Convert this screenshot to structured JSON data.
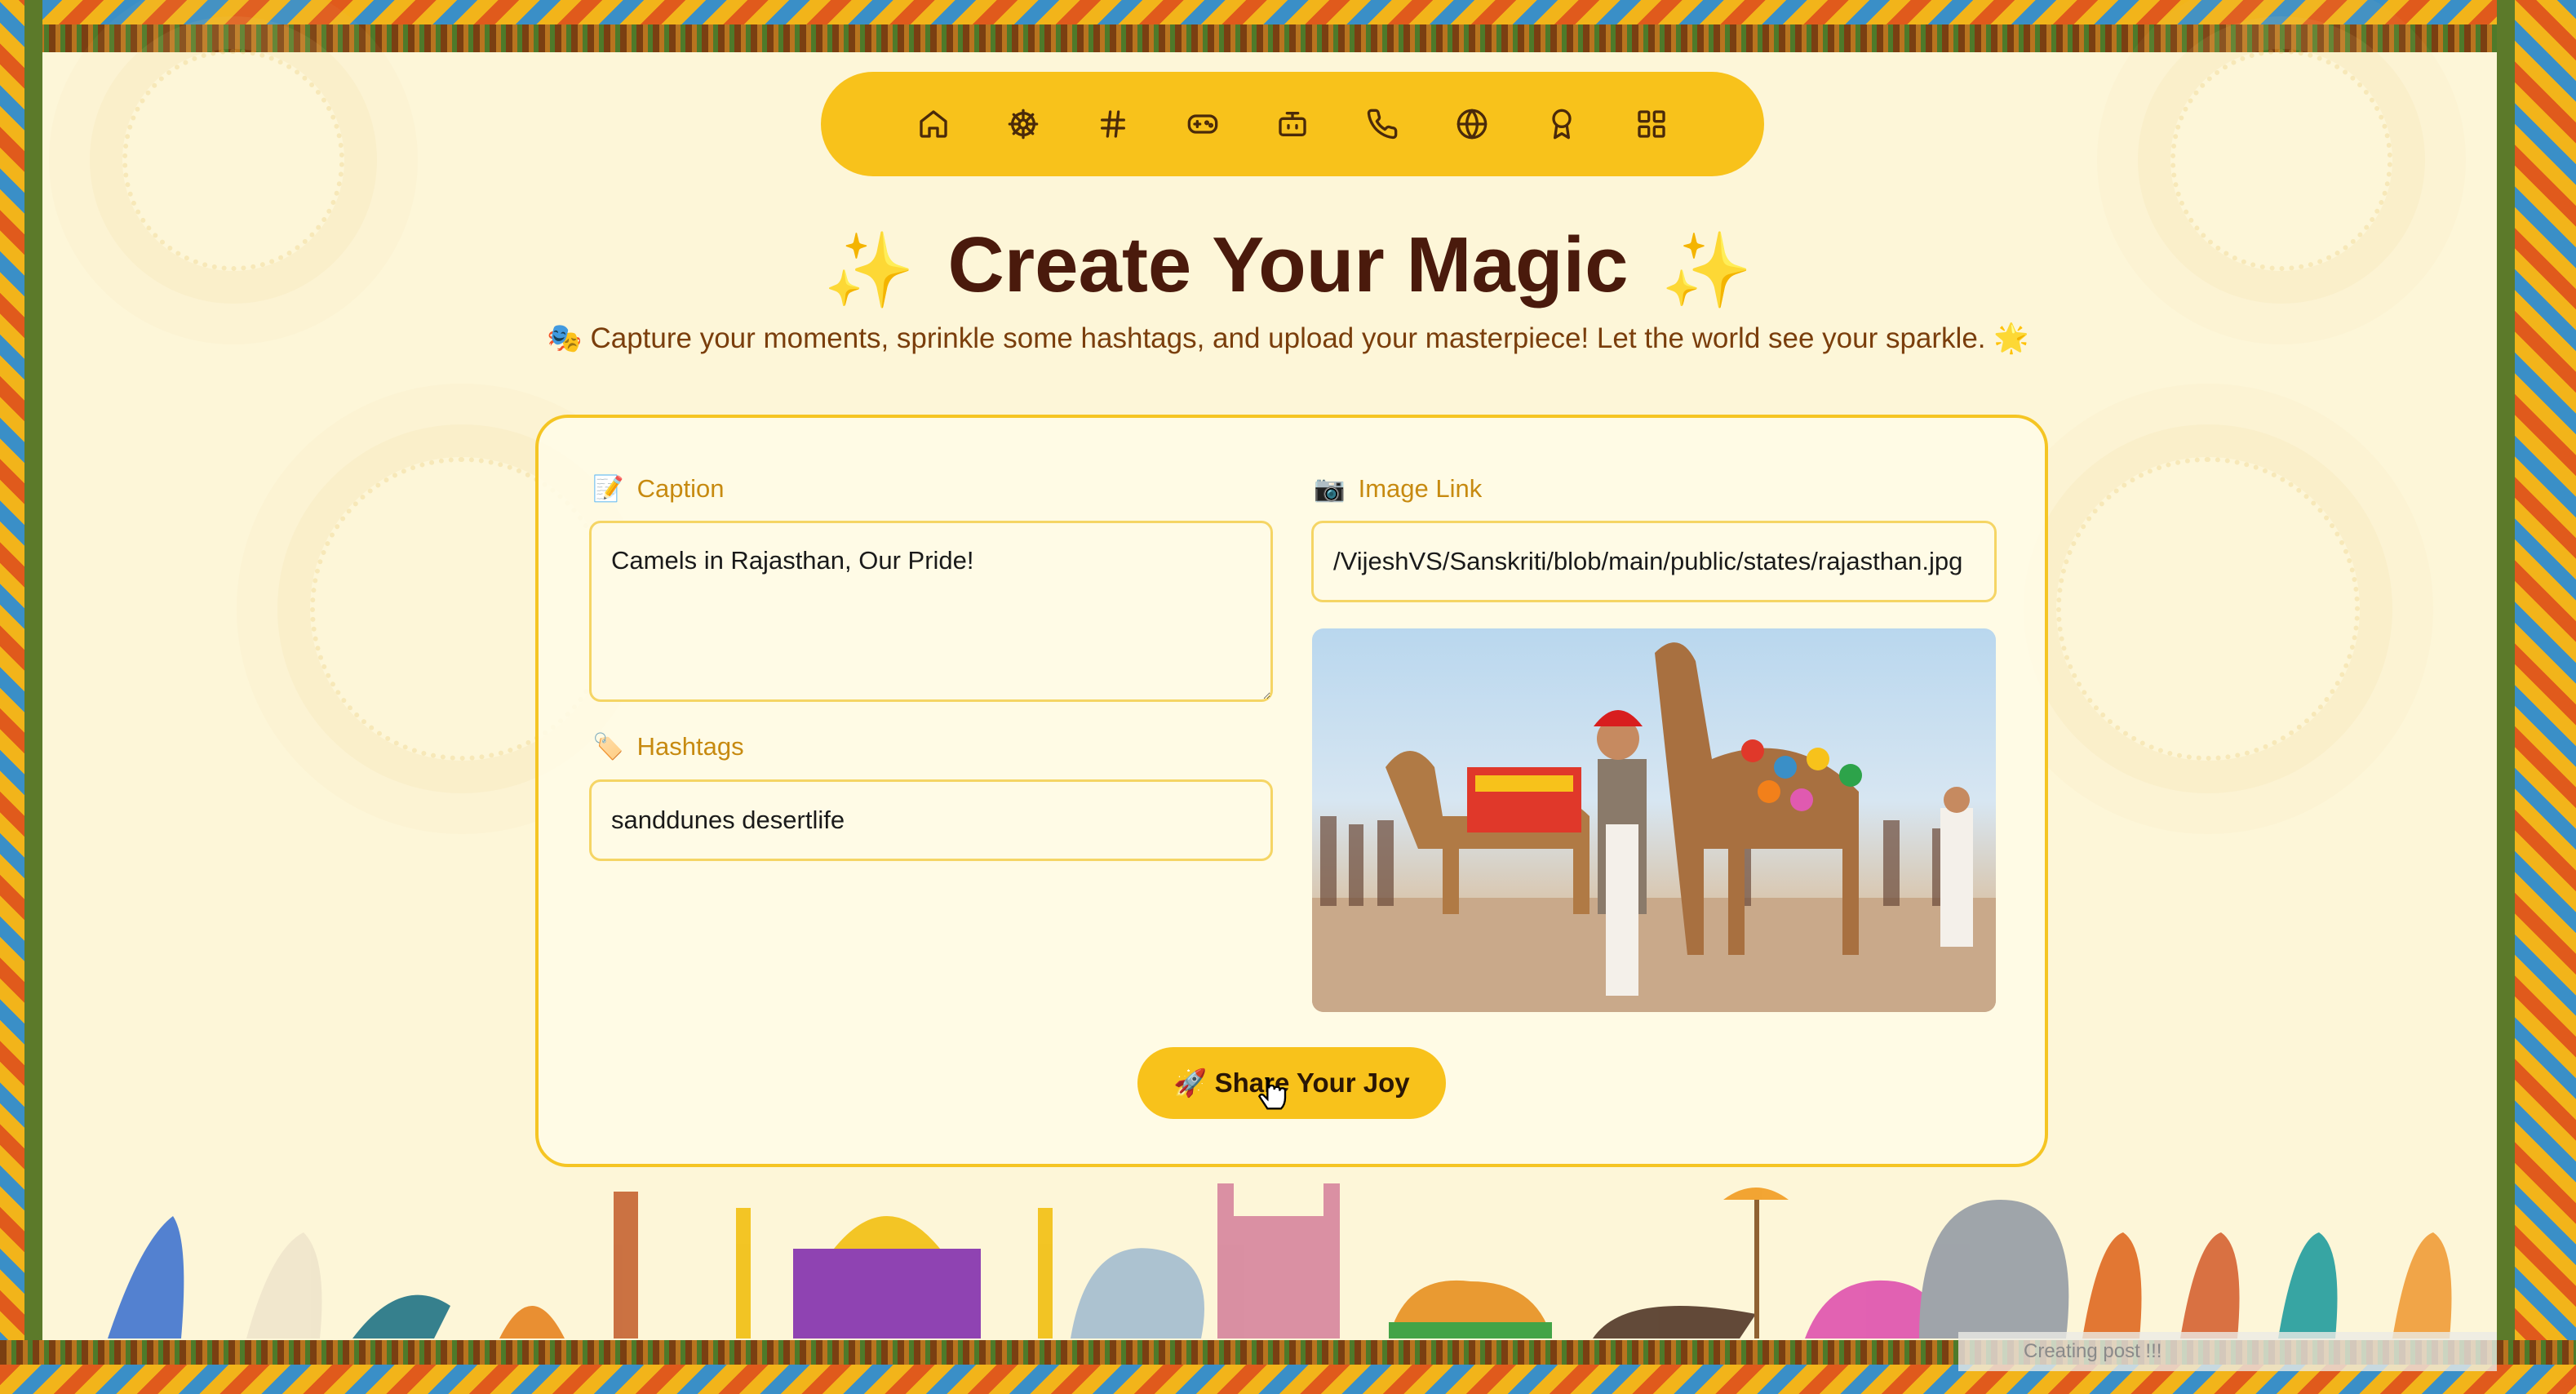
{
  "nav": {
    "items": [
      "home-icon",
      "ship-wheel-icon",
      "hashtag-icon",
      "gamepad-icon",
      "bot-icon",
      "phone-icon",
      "globe-icon",
      "award-icon",
      "grid-icon"
    ]
  },
  "heading": {
    "spark_left": "✨",
    "title": "Create Your Magic",
    "spark_right": "✨",
    "subtitle": "🎭 Capture your moments, sprinkle some hashtags, and upload your masterpiece! Let the world see your sparkle. 🌟"
  },
  "form": {
    "caption_icon": "📝",
    "caption_label": "Caption",
    "caption_value": "Camels in Rajasthan, Our Pride!",
    "hashtags_icon": "🏷️",
    "hashtags_label": "Hashtags",
    "hashtags_value": "sanddunes desertlife",
    "image_icon": "📷",
    "image_label": "Image Link",
    "image_value": "/VijeshVS/Sanskriti/blob/main/public/states/rajasthan.jpg",
    "share_label": "🚀 Share Your Joy"
  },
  "toast": {
    "text": "Creating post !!!"
  },
  "colors": {
    "accent": "#f8c21b",
    "title": "#4a1a0c",
    "background": "#fdf6d8"
  }
}
